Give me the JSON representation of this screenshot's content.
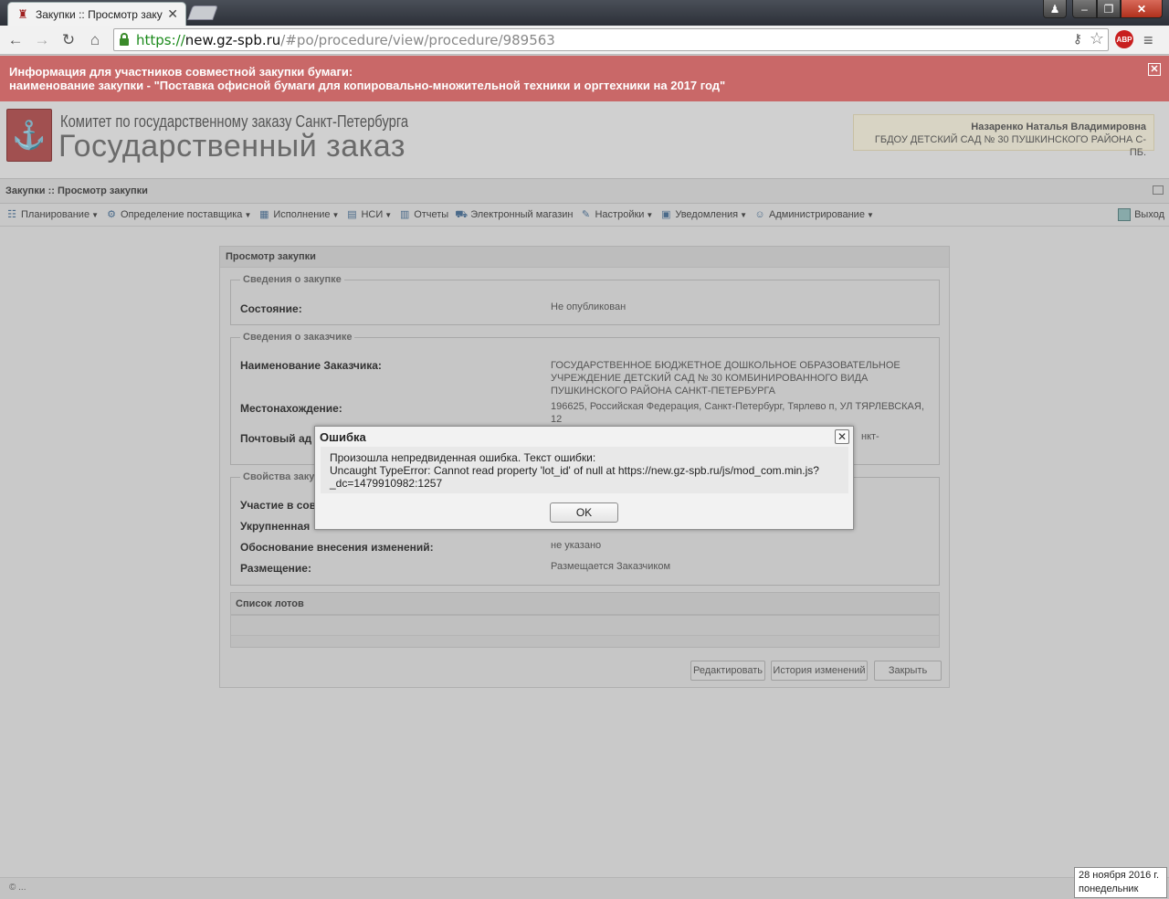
{
  "browser": {
    "tab_title": "Закупки :: Просмотр заку",
    "url_scheme": "https://",
    "url_host": "new.gz-spb.ru",
    "url_path": "/#po/procedure/view/procedure/989563",
    "abp_label": "ABP"
  },
  "banner": {
    "line1": "Информация для участников совместной закупки бумаги:",
    "line2": "наименование закупки - \"Поставка офисной бумаги для копировально-множительной техники и оргтехники на 2017 год\""
  },
  "header": {
    "org_line1": "Комитет по государственному заказу Санкт-Петербурга",
    "org_line2": "Государственный заказ",
    "user_name": "Назаренко Наталья Владимировна",
    "user_org": "ГБДОУ ДЕТСКИЙ САД № 30 ПУШКИНСКОГО РАЙОНА С-ПБ."
  },
  "panel_title": "Закупки :: Просмотр закупки",
  "menu": {
    "items": [
      {
        "label": "Планирование",
        "icon": "planning-icon",
        "dropdown": true
      },
      {
        "label": "Определение поставщика",
        "icon": "gears-icon",
        "dropdown": true
      },
      {
        "label": "Исполнение",
        "icon": "execution-icon",
        "dropdown": true
      },
      {
        "label": "НСИ",
        "icon": "book-icon",
        "dropdown": true
      },
      {
        "label": "Отчеты",
        "icon": "report-icon",
        "dropdown": false
      },
      {
        "label": "Электронный магазин",
        "icon": "cart-icon",
        "dropdown": false
      },
      {
        "label": "Настройки",
        "icon": "wrench-icon",
        "dropdown": true
      },
      {
        "label": "Уведомления",
        "icon": "notification-icon",
        "dropdown": true
      },
      {
        "label": "Администрирование",
        "icon": "user-icon",
        "dropdown": true
      }
    ],
    "exit_label": "Выход"
  },
  "view": {
    "title": "Просмотр закупки",
    "section_purchase": {
      "legend": "Сведения о закупке",
      "state_label": "Состояние:",
      "state_value": "Не опубликован"
    },
    "section_customer": {
      "legend": "Сведения о заказчике",
      "name_label": "Наименование Заказчика:",
      "name_value": "ГОСУДАРСТВЕННОЕ БЮДЖЕТНОЕ ДОШКОЛЬНОЕ ОБРАЗОВАТЕЛЬНОЕ УЧРЕЖДЕНИЕ ДЕТСКИЙ САД № 30 КОМБИНИРОВАННОГО ВИДА ПУШКИНСКОГО РАЙОНА САНКТ-ПЕТЕРБУРГА",
      "location_label": "Местонахождение:",
      "location_value": "196625, Российская Федерация, Санкт-Петербург, Тярлево п, УЛ ТЯРЛЕВСКАЯ, 12",
      "postal_label": "Почтовый ад",
      "postal_value_fragment": "нкт-"
    },
    "section_props": {
      "legend": "Свойства заку",
      "participation_label": "Участие в сов",
      "consolidated_label": "Укрупненная",
      "reason_label": "Обоснование внесения изменений:",
      "reason_value": "не указано",
      "placement_label": "Размещение:",
      "placement_value": "Размещается Заказчиком"
    },
    "lots_title": "Список лотов",
    "buttons": {
      "edit": "Редактировать",
      "history": "История изменений",
      "close": "Закрыть"
    }
  },
  "modal": {
    "title": "Ошибка",
    "line1": "Произошла непредвиденная ошибка. Текст ошибки:",
    "line2": "Uncaught TypeError: Cannot read property 'lot_id' of null at https://new.gz-spb.ru/js/mod_com.min.js?",
    "line3": "_dc=1479910982:1257",
    "ok_label": "OK"
  },
  "statusbar": {
    "copyright": "© ..."
  },
  "taskbar_clock": {
    "date": "28 ноября 2016 г.",
    "weekday": "понедельник"
  }
}
